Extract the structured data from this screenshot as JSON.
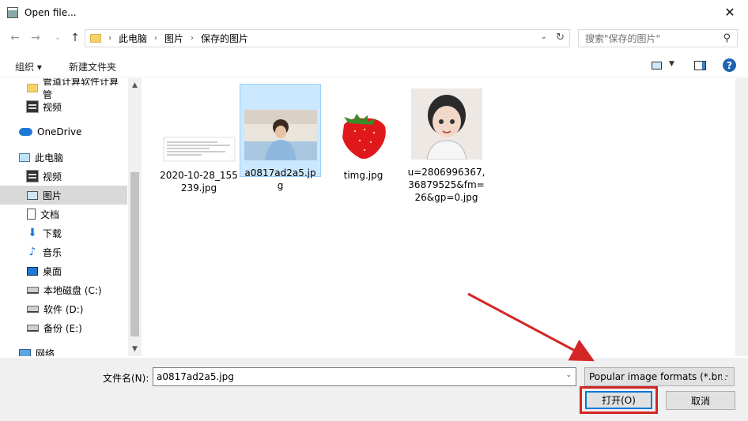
{
  "window": {
    "title": "Open file..."
  },
  "address": {
    "crumbs": [
      "此电脑",
      "图片",
      "保存的图片"
    ]
  },
  "search": {
    "placeholder": "搜索\"保存的图片\""
  },
  "toolbar": {
    "organize_label": "组织 ▾",
    "new_folder_label": "新建文件夹"
  },
  "sidebar": {
    "items": [
      {
        "label": "管道计算软件计算管",
        "icon": "folder-icon"
      },
      {
        "label": "视频",
        "icon": "video-icon"
      },
      {
        "label": "OneDrive",
        "icon": "cloud-icon"
      },
      {
        "label": "此电脑",
        "icon": "computer-icon"
      },
      {
        "label": "视频",
        "icon": "video-icon"
      },
      {
        "label": "图片",
        "icon": "pictures-icon"
      },
      {
        "label": "文档",
        "icon": "document-icon"
      },
      {
        "label": "下载",
        "icon": "download-icon"
      },
      {
        "label": "音乐",
        "icon": "music-icon"
      },
      {
        "label": "桌面",
        "icon": "desktop-icon"
      },
      {
        "label": "本地磁盘 (C:)",
        "icon": "disk-icon"
      },
      {
        "label": "软件 (D:)",
        "icon": "disk-icon"
      },
      {
        "label": "备份 (E:)",
        "icon": "disk-icon"
      },
      {
        "label": "网络",
        "icon": "network-icon"
      }
    ],
    "selected": "图片"
  },
  "files": [
    {
      "name": "2020-10-28_155239.jpg"
    },
    {
      "name": "a0817ad2a5.jpg"
    },
    {
      "name": "timg.jpg"
    },
    {
      "name": "u=2806996367,36879525&fm=26&gp=0.jpg"
    }
  ],
  "selected_file": "a0817ad2a5.jpg",
  "bottom": {
    "filename_label": "文件名(N):",
    "filename_value": "a0817ad2a5.jpg",
    "filter_value": "Popular image formats (*.bm",
    "open_label": "打开(O)",
    "cancel_label": "取消"
  },
  "colors": {
    "selection": "#cce8ff",
    "accent": "#0078d7",
    "highlight_red": "#d42626"
  }
}
